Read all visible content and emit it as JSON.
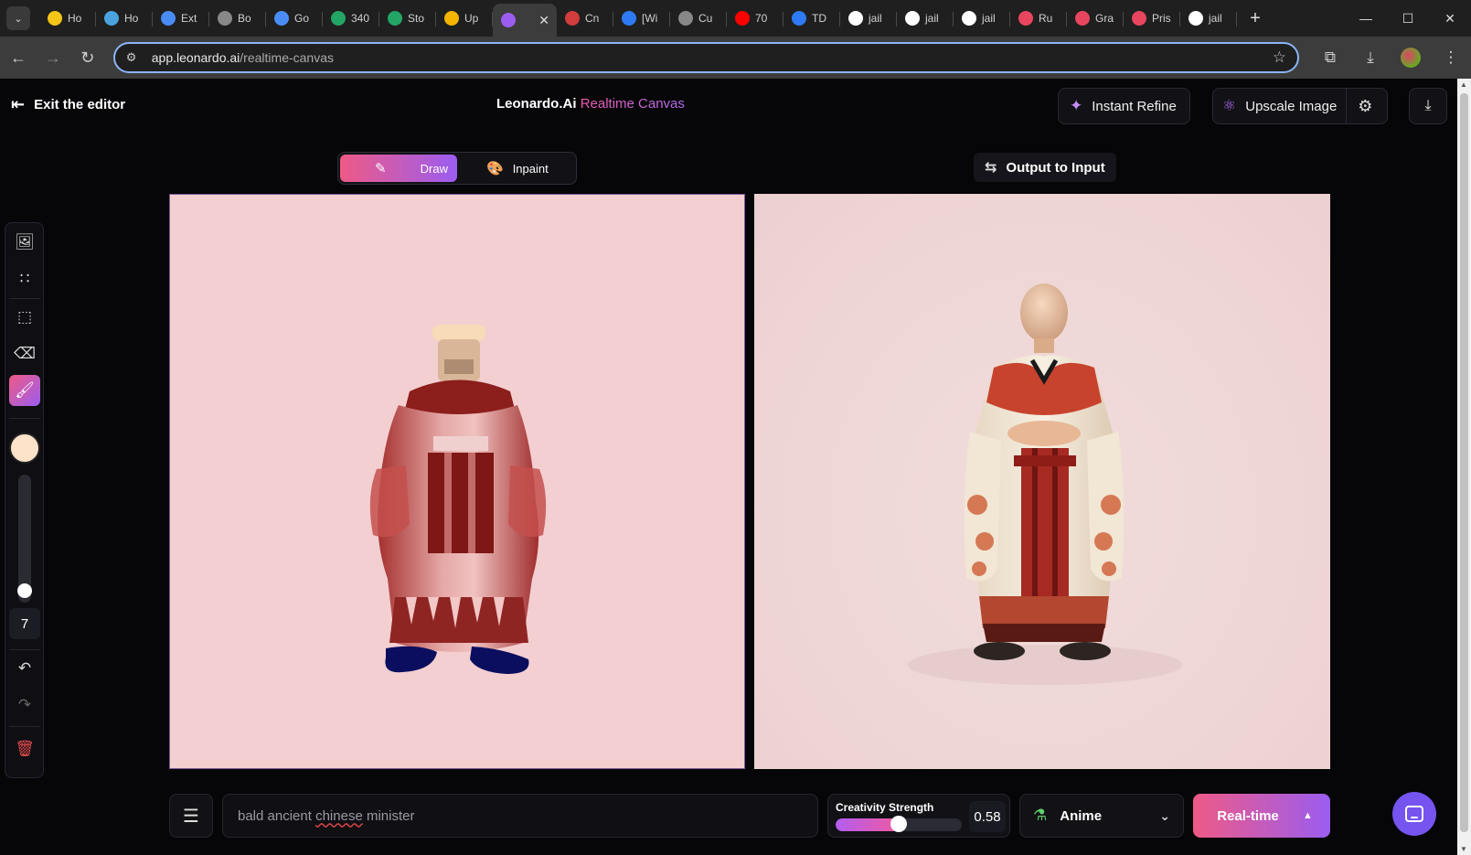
{
  "browser": {
    "tabs": [
      {
        "label": "Ho",
        "icon": "smiley-icon",
        "color": "#f5c518"
      },
      {
        "label": "Ho",
        "icon": "monitor-icon",
        "color": "#4aa3df"
      },
      {
        "label": "Ext",
        "icon": "puzzle-icon",
        "color": "#4a8cf5"
      },
      {
        "label": "Bo",
        "icon": "openai-icon",
        "color": "#888888"
      },
      {
        "label": "Go",
        "icon": "translate-icon",
        "color": "#4a8cf5"
      },
      {
        "label": "340",
        "icon": "sheet-icon",
        "color": "#23a566"
      },
      {
        "label": "Sto",
        "icon": "ticket-icon",
        "color": "#23a566"
      },
      {
        "label": "Up",
        "icon": "slides-icon",
        "color": "#f4b400"
      },
      {
        "label": "",
        "icon": "leonardo-icon",
        "color": "#9b5df0",
        "active": true
      },
      {
        "label": "Cn",
        "icon": "gate-icon",
        "color": "#d13c3c"
      },
      {
        "label": "[Wi",
        "icon": "diamond-icon",
        "color": "#2f7bf5"
      },
      {
        "label": "Cu",
        "icon": "globe-icon",
        "color": "#888888"
      },
      {
        "label": "70",
        "icon": "youtube-icon",
        "color": "#ff0000"
      },
      {
        "label": "TD",
        "icon": "diamond-icon",
        "color": "#2f7bf5"
      },
      {
        "label": "jail",
        "icon": "google-icon",
        "color": "#ffffff"
      },
      {
        "label": "jail",
        "icon": "google-icon",
        "color": "#ffffff"
      },
      {
        "label": "jail",
        "icon": "google-icon",
        "color": "#ffffff"
      },
      {
        "label": "Ru",
        "icon": "swirl-icon",
        "color": "#e8455f"
      },
      {
        "label": "Gra",
        "icon": "swirl-icon",
        "color": "#e8455f"
      },
      {
        "label": "Pris",
        "icon": "swirl-icon",
        "color": "#e8455f"
      },
      {
        "label": "jail",
        "icon": "google-icon",
        "color": "#ffffff"
      }
    ],
    "new_tab": "+",
    "url_host": "app.leonardo.ai",
    "url_path": "/realtime-canvas"
  },
  "header": {
    "exit_label": "Exit the editor",
    "title_main": "Leonardo.Ai",
    "title_accent": "Realtime Canvas",
    "instant_refine": "Instant Refine",
    "upscale_image": "Upscale Image"
  },
  "modes": {
    "draw": "Draw",
    "inpaint": "Inpaint",
    "selected": "Draw"
  },
  "output_to_input": "Output to Input",
  "toolbar": {
    "brush_color": "#fde3c9",
    "brush_size": "7",
    "brush_size_level": 0.04
  },
  "bottom": {
    "prompt": "bald ancient chinese minister",
    "prompt_pre": "bald ancient ",
    "prompt_mark": "chinese",
    "prompt_post": " minister",
    "creativity_label": "Creativity Strength",
    "creativity_value": "0.58",
    "creativity_level": 0.5,
    "style": "Anime",
    "generate_label": "Real-time"
  },
  "colors": {
    "accent_start": "#ee5a86",
    "accent_end": "#9b5df0",
    "canvas_bg": "#f3cfd1"
  }
}
